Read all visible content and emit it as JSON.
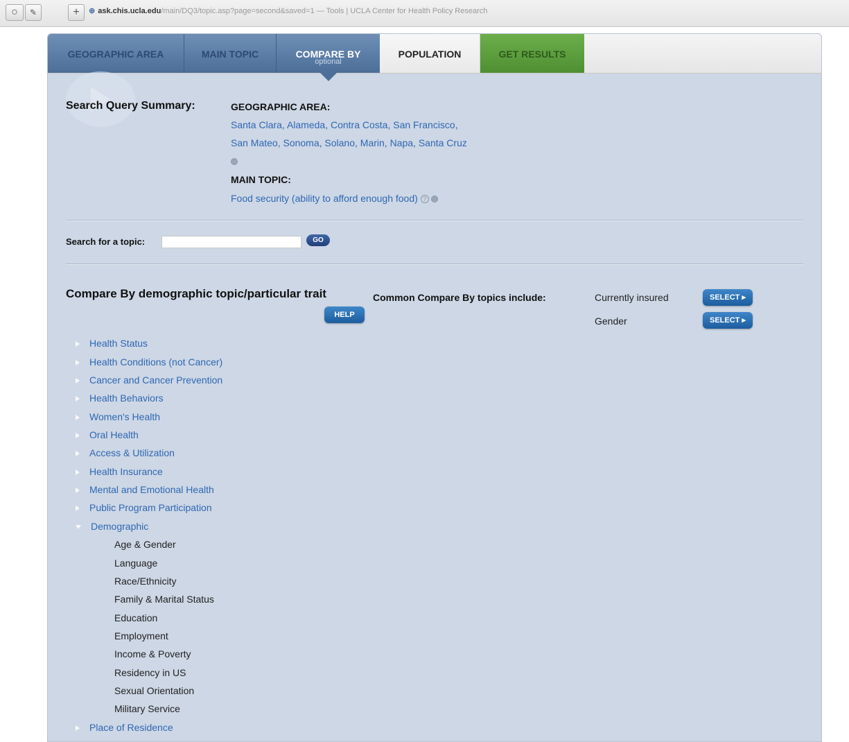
{
  "browser": {
    "url_host": "ask.chis.ucla.edu",
    "url_rest": "/main/DQ3/topic.asp?page=second&saved=1 — Tools | UCLA Center for Health Policy Research"
  },
  "tabs": [
    {
      "label": "GEOGRAPHIC AREA"
    },
    {
      "label": "MAIN TOPIC"
    },
    {
      "label": "COMPARE BY",
      "sub": "optional"
    },
    {
      "label": "POPULATION"
    },
    {
      "label": "GET RESULTS"
    }
  ],
  "summary": {
    "heading": "Search Query Summary:",
    "geo_label": "GEOGRAPHIC AREA:",
    "geo_line1": "Santa Clara, Alameda, Contra Costa, San Francisco,",
    "geo_line2": "San Mateo, Sonoma, Solano, Marin, Napa, Santa Cruz",
    "topic_label": "MAIN TOPIC:",
    "topic_value": "Food security (ability to afford enough food)",
    "help_glyph": "?"
  },
  "search": {
    "label": "Search for a topic:",
    "value": "",
    "go_label": "GO"
  },
  "compare": {
    "heading": "Compare By demographic topic/particular trait",
    "help_label": "HELP",
    "common_label": "Common Compare By topics include:",
    "common": [
      {
        "name": "Currently insured",
        "button": "SELECT ▸"
      },
      {
        "name": "Gender",
        "button": "SELECT ▸"
      }
    ]
  },
  "topics": [
    "Health Status",
    "Health Conditions (not Cancer)",
    "Cancer and Cancer Prevention",
    "Health Behaviors",
    "Women's Health",
    "Oral Health",
    "Access & Utilization",
    "Health Insurance",
    "Mental and Emotional Health",
    "Public Program Participation",
    "Demographic"
  ],
  "demographic_subtopics": [
    "Age & Gender",
    "Language",
    "Race/Ethnicity",
    "Family & Marital Status",
    "Education",
    "Employment",
    "Income & Poverty",
    "Residency in US",
    "Sexual Orientation",
    "Military Service"
  ],
  "last_topic": "Place of Residence"
}
